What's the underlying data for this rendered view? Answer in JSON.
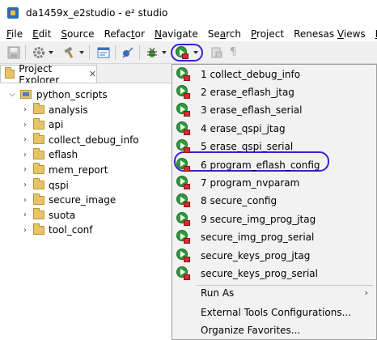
{
  "window": {
    "title": "da1459x_e2studio - e² studio"
  },
  "menubar": {
    "items": [
      {
        "pre": "",
        "u": "F",
        "post": "ile"
      },
      {
        "pre": "",
        "u": "E",
        "post": "dit"
      },
      {
        "pre": "",
        "u": "S",
        "post": "ource"
      },
      {
        "pre": "Refac",
        "u": "t",
        "post": "or"
      },
      {
        "pre": "",
        "u": "N",
        "post": "avigate"
      },
      {
        "pre": "Se",
        "u": "a",
        "post": "rch"
      },
      {
        "pre": "",
        "u": "P",
        "post": "roject"
      },
      {
        "pre": "Renesas ",
        "u": "V",
        "post": "iews"
      },
      {
        "pre": "",
        "u": "R",
        "post": "un"
      }
    ]
  },
  "explorer": {
    "tab_label": "Project Explorer",
    "close_glyph": "✕",
    "project": "python_scripts",
    "folders": [
      "analysis",
      "api",
      "collect_debug_info",
      "eflash",
      "mem_report",
      "qspi",
      "secure_image",
      "suota",
      "tool_conf"
    ]
  },
  "dropdown": {
    "items": [
      "1 collect_debug_info",
      "2 erase_eflash_jtag",
      "3 erase_eflash_serial",
      "4 erase_qspi_jtag",
      "5 erase_qspi_serial",
      "6 program_eflash_config",
      "7 program_nvparam",
      "8 secure_config",
      "9 secure_img_prog_jtag",
      "secure_img_prog_serial",
      "secure_keys_prog_jtag",
      "secure_keys_prog_serial"
    ],
    "run_as": "Run As",
    "external_tools": "External Tools Configurations...",
    "organize": "Organize Favorites...",
    "submenu_glyph": "›"
  },
  "colors": {
    "highlight": "#3a1fd6",
    "run_green": "#2e9b3a",
    "toolbox_red": "#d62c2c",
    "folder": "#e7c468"
  }
}
